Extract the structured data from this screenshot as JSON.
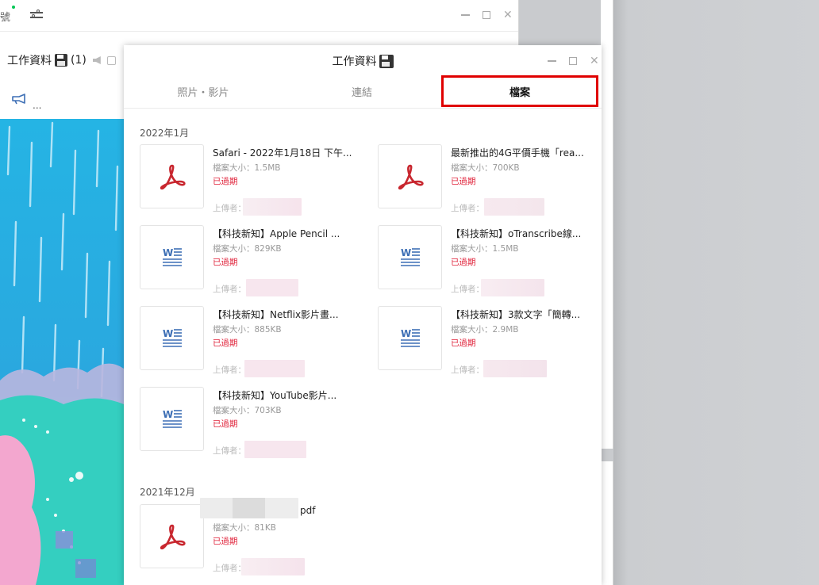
{
  "chat": {
    "tab_partial": "號",
    "title": "工作資料",
    "badge": "(1)",
    "more": "..."
  },
  "files_window": {
    "title": "工作資料",
    "tabs": [
      {
        "label": "照片・影片",
        "active": false
      },
      {
        "label": "連結",
        "active": false
      },
      {
        "label": "檔案",
        "active": true
      }
    ],
    "uploader_label": "上傳者：",
    "expired_label": "已過期",
    "accent_color": "#e00000",
    "expired_color": "#e0233b",
    "sections": [
      {
        "date": "2022年1月",
        "files": [
          {
            "name": "Safari - 2022年1月18日 下午...",
            "size": "檔案大小：1.5MB",
            "status": "已過期",
            "type": "pdf-icon"
          },
          {
            "name": "最新推出的4G平價手機「rea...",
            "size": "檔案大小：700KB",
            "status": "已過期",
            "type": "pdf-icon"
          },
          {
            "name": "【科技新知】Apple Pencil ...",
            "size": "檔案大小：829KB",
            "status": "已過期",
            "type": "word-icon"
          },
          {
            "name": "【科技新知】oTranscribe線...",
            "size": "檔案大小：1.5MB",
            "status": "已過期",
            "type": "word-icon"
          },
          {
            "name": "【科技新知】Netflix影片畫...",
            "size": "檔案大小：885KB",
            "status": "已過期",
            "type": "word-icon"
          },
          {
            "name": "【科技新知】3款文字「簡轉...",
            "size": "檔案大小：2.9MB",
            "status": "已過期",
            "type": "word-icon"
          },
          {
            "name": "【科技新知】YouTube影片...",
            "size": "檔案大小：703KB",
            "status": "已過期",
            "type": "word-icon"
          }
        ]
      },
      {
        "date": "2021年12月",
        "files": [
          {
            "name": "pdf",
            "size": "檔案大小：81KB",
            "status": "已過期",
            "type": "pdf-icon"
          }
        ]
      }
    ]
  }
}
